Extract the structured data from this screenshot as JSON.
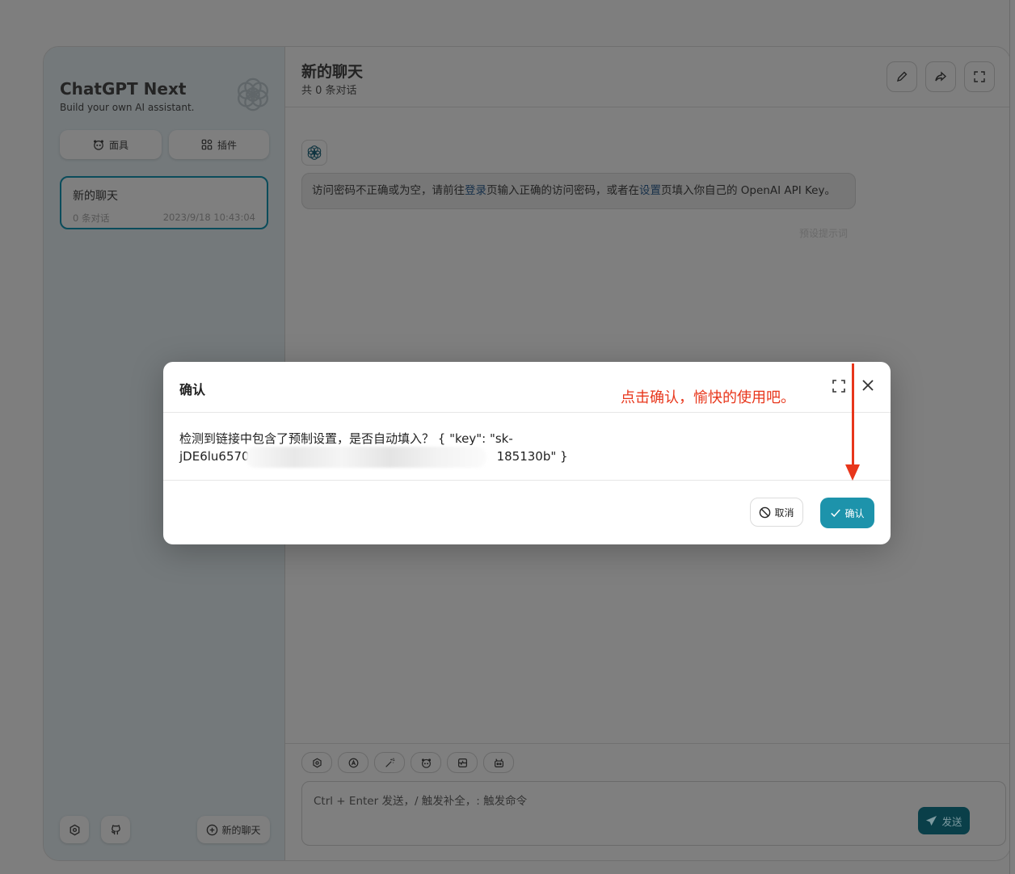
{
  "colors": {
    "overlay": "#7f7f7f",
    "accent": "#1d93ab",
    "annotation": "#e8361b",
    "modal_bg": "#ffffff"
  },
  "sidebar": {
    "title": "ChatGPT Next",
    "subtitle": "Build your own AI assistant.",
    "buttons": [
      {
        "label": "面具",
        "icon": "mask-icon"
      },
      {
        "label": "插件",
        "icon": "plugin-icon"
      }
    ],
    "chats": [
      {
        "title": "新的聊天",
        "count": "0 条对话",
        "time": "2023/9/18 10:43:04"
      }
    ],
    "footer": {
      "new_chat_label": "新的聊天"
    }
  },
  "header": {
    "title": "新的聊天",
    "subtitle": "共 0 条对话"
  },
  "messages": [
    {
      "role": "bot",
      "text_1": "访问密码不正确或为空，请前往",
      "link_1": "登录",
      "text_2": "页输入正确的访问密码，或者在",
      "link_2": "设置",
      "text_3": "页填入你自己的 OpenAI API Key。",
      "time": "预设提示词"
    }
  ],
  "input": {
    "placeholder": "Ctrl + Enter 发送，/ 触发补全，: 触发命令",
    "send_label": "发送"
  },
  "modal": {
    "title": "确认",
    "body_prefix": "检测到链接中包含了预制设置，是否自动填入？ { \"key\": \"sk-",
    "body_line2_start": "jDE6lu6570",
    "body_line2_end": "185130b\" }",
    "cancel_label": "取消",
    "confirm_label": "确认"
  },
  "annotation": {
    "text": "点击确认，愉快的使用吧。"
  }
}
